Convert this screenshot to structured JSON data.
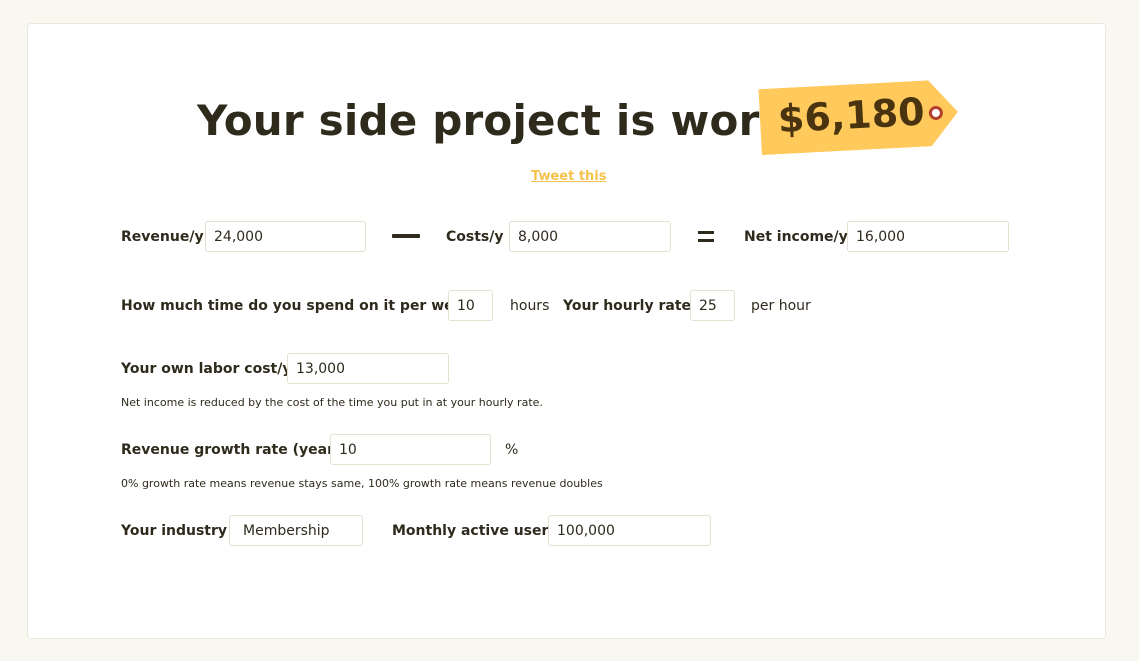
{
  "headline": "Your side project is worth",
  "valuation": "$6,180",
  "tweet_label": "Tweet this",
  "colors": {
    "tag_fill": "#ffc95b",
    "tag_text": "#4a3410",
    "tag_hole_ring": "#b2402a",
    "link": "#f5c24d",
    "page_bg": "#f8f8f1"
  },
  "revenue": {
    "label": "Revenue/y",
    "value": "24,000"
  },
  "costs": {
    "label": "Costs/y",
    "value": "8,000"
  },
  "net_income": {
    "label": "Net income/y",
    "value": "16,000"
  },
  "time": {
    "label": "How much time do you spend on it per week?",
    "value": "10",
    "unit": "hours"
  },
  "hourly_rate": {
    "label": "Your hourly rate",
    "value": "25",
    "unit": "per hour"
  },
  "labor_cost": {
    "label": "Your own labor cost/y",
    "value": "13,000",
    "note": "Net income is reduced by the cost of the time you put in at your hourly rate."
  },
  "growth": {
    "label": "Revenue growth rate (yearly)",
    "value": "10",
    "unit": "%",
    "note": "0% growth rate means revenue stays same, 100% growth rate means revenue doubles"
  },
  "industry": {
    "label": "Your industry",
    "value": "Membership"
  },
  "mau": {
    "label": "Monthly active users",
    "value": "100,000"
  }
}
